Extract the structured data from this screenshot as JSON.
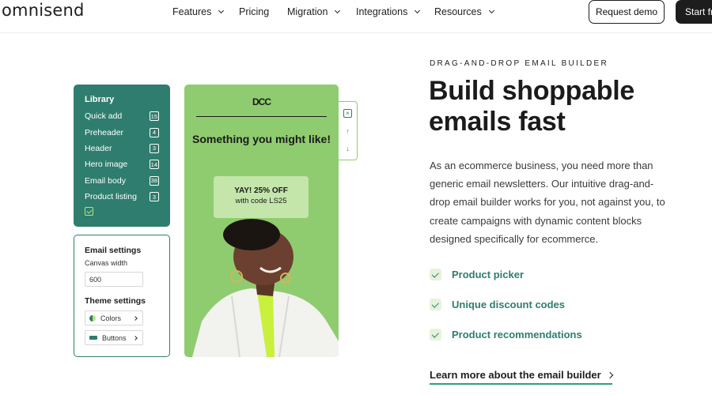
{
  "header": {
    "logo": "omnisend",
    "nav": [
      {
        "label": "Features",
        "dropdown": true
      },
      {
        "label": "Pricing",
        "dropdown": false
      },
      {
        "label": "Migration",
        "dropdown": true
      },
      {
        "label": "Integrations",
        "dropdown": true
      },
      {
        "label": "Resources",
        "dropdown": true
      }
    ],
    "request_demo": "Request demo",
    "start_free": "Start fr"
  },
  "builder": {
    "library": {
      "title": "Library",
      "items": [
        {
          "label": "Quick add",
          "count": "15"
        },
        {
          "label": "Preheader",
          "count": "4"
        },
        {
          "label": "Header",
          "count": "3"
        },
        {
          "label": "Hero image",
          "count": "14"
        },
        {
          "label": "Email body",
          "count": "38"
        },
        {
          "label": "Product listing",
          "count": "3"
        }
      ]
    },
    "settings": {
      "title": "Email settings",
      "canvas_label": "Canvas width",
      "canvas_value": "600",
      "theme_title": "Theme settings",
      "colors_label": "Colors",
      "buttons_label": "Buttons"
    },
    "preview": {
      "logo": "DCC",
      "heading": "Something you might like!",
      "offer_title": "YAY! 25% OFF",
      "offer_code": "with code LS25"
    },
    "colors": {
      "brand_dark": "#2f7d6e",
      "preview_green": "#8fcc6f",
      "offer_bg": "#c4e6ab"
    }
  },
  "content": {
    "eyebrow": "DRAG-AND-DROP EMAIL BUILDER",
    "headline": "Build shoppable emails fast",
    "body": "As an ecommerce business, you need more than generic email newsletters. Our intuitive drag-and-drop email builder works for you, not against you, to create campaigns with dynamic content blocks designed specifically for ecommerce.",
    "features": [
      "Product picker",
      "Unique discount codes",
      "Product recommendations"
    ],
    "learn_more": "Learn more about the email builder"
  }
}
